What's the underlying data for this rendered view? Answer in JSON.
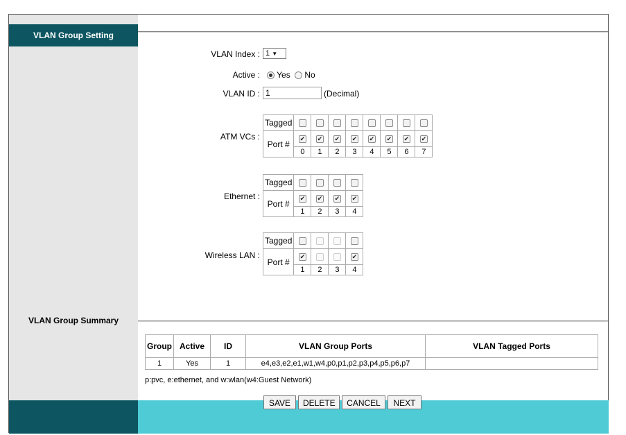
{
  "section_titles": {
    "group_setting": "VLAN Group Setting",
    "group_summary": "VLAN Group Summary"
  },
  "form": {
    "vlan_index_label": "VLAN Index :",
    "vlan_index_value": "1",
    "active_label": "Active :",
    "active_yes": "Yes",
    "active_no": "No",
    "active_selected": "Yes",
    "vlan_id_label": "VLAN ID :",
    "vlan_id_value": "1",
    "vlan_id_hint": "(Decimal)"
  },
  "port_groups": [
    {
      "label": "ATM VCs :",
      "tagged_label": "Tagged",
      "port_label": "Port #",
      "ports": [
        "0",
        "1",
        "2",
        "3",
        "4",
        "5",
        "6",
        "7"
      ],
      "tagged": [
        false,
        false,
        false,
        false,
        false,
        false,
        false,
        false
      ],
      "port_checked": [
        true,
        true,
        true,
        true,
        true,
        true,
        true,
        true
      ],
      "tagged_disabled": [
        false,
        false,
        false,
        false,
        false,
        false,
        false,
        false
      ],
      "port_disabled": [
        false,
        false,
        false,
        false,
        false,
        false,
        false,
        false
      ]
    },
    {
      "label": "Ethernet :",
      "tagged_label": "Tagged",
      "port_label": "Port #",
      "ports": [
        "1",
        "2",
        "3",
        "4"
      ],
      "tagged": [
        false,
        false,
        false,
        false
      ],
      "port_checked": [
        true,
        true,
        true,
        true
      ],
      "tagged_disabled": [
        false,
        false,
        false,
        false
      ],
      "port_disabled": [
        false,
        false,
        false,
        false
      ]
    },
    {
      "label": "Wireless LAN :",
      "tagged_label": "Tagged",
      "port_label": "Port #",
      "ports": [
        "1",
        "2",
        "3",
        "4"
      ],
      "tagged": [
        false,
        false,
        false,
        false
      ],
      "port_checked": [
        true,
        false,
        false,
        true
      ],
      "tagged_disabled": [
        false,
        true,
        true,
        false
      ],
      "port_disabled": [
        false,
        true,
        true,
        false
      ]
    }
  ],
  "summary": {
    "headers": [
      "Group",
      "Active",
      "ID",
      "VLAN Group Ports",
      "VLAN Tagged Ports"
    ],
    "rows": [
      [
        "1",
        "Yes",
        "1",
        "e4,e3,e2,e1,w1,w4,p0,p1,p2,p3,p4,p5,p6,p7",
        ""
      ]
    ],
    "legend": "p:pvc, e:ethernet, and w:wlan(w4:Guest Network)"
  },
  "buttons": {
    "save": "SAVE",
    "delete": "DELETE",
    "cancel": "CANCEL",
    "next": "NEXT"
  },
  "colors": {
    "header_teal": "#0d5661",
    "footer_cyan": "#4fcbd6",
    "sidebar_gray": "#e6e6e6"
  }
}
